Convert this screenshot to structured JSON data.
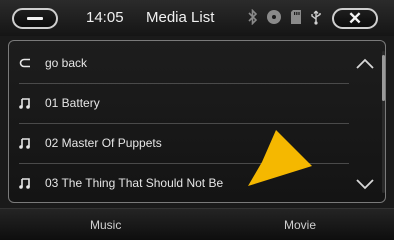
{
  "header": {
    "time": "14:05",
    "title": "Media List",
    "status_icons": [
      "bluetooth-icon",
      "disc-icon",
      "sd-card-icon",
      "usb-icon"
    ]
  },
  "list": {
    "items": [
      {
        "icon": "back-arrow-icon",
        "label": "go back"
      },
      {
        "icon": "music-note-icon",
        "label": "01 Battery"
      },
      {
        "icon": "music-note-icon",
        "label": "02 Master Of Puppets"
      },
      {
        "icon": "music-note-icon",
        "label": "03 The Thing That Should Not Be"
      }
    ]
  },
  "tabs": {
    "music": "Music",
    "movie": "Movie"
  },
  "colors": {
    "pointer": "#f5b800",
    "background": "#1a1a1a",
    "text": "#e8e8e8"
  }
}
